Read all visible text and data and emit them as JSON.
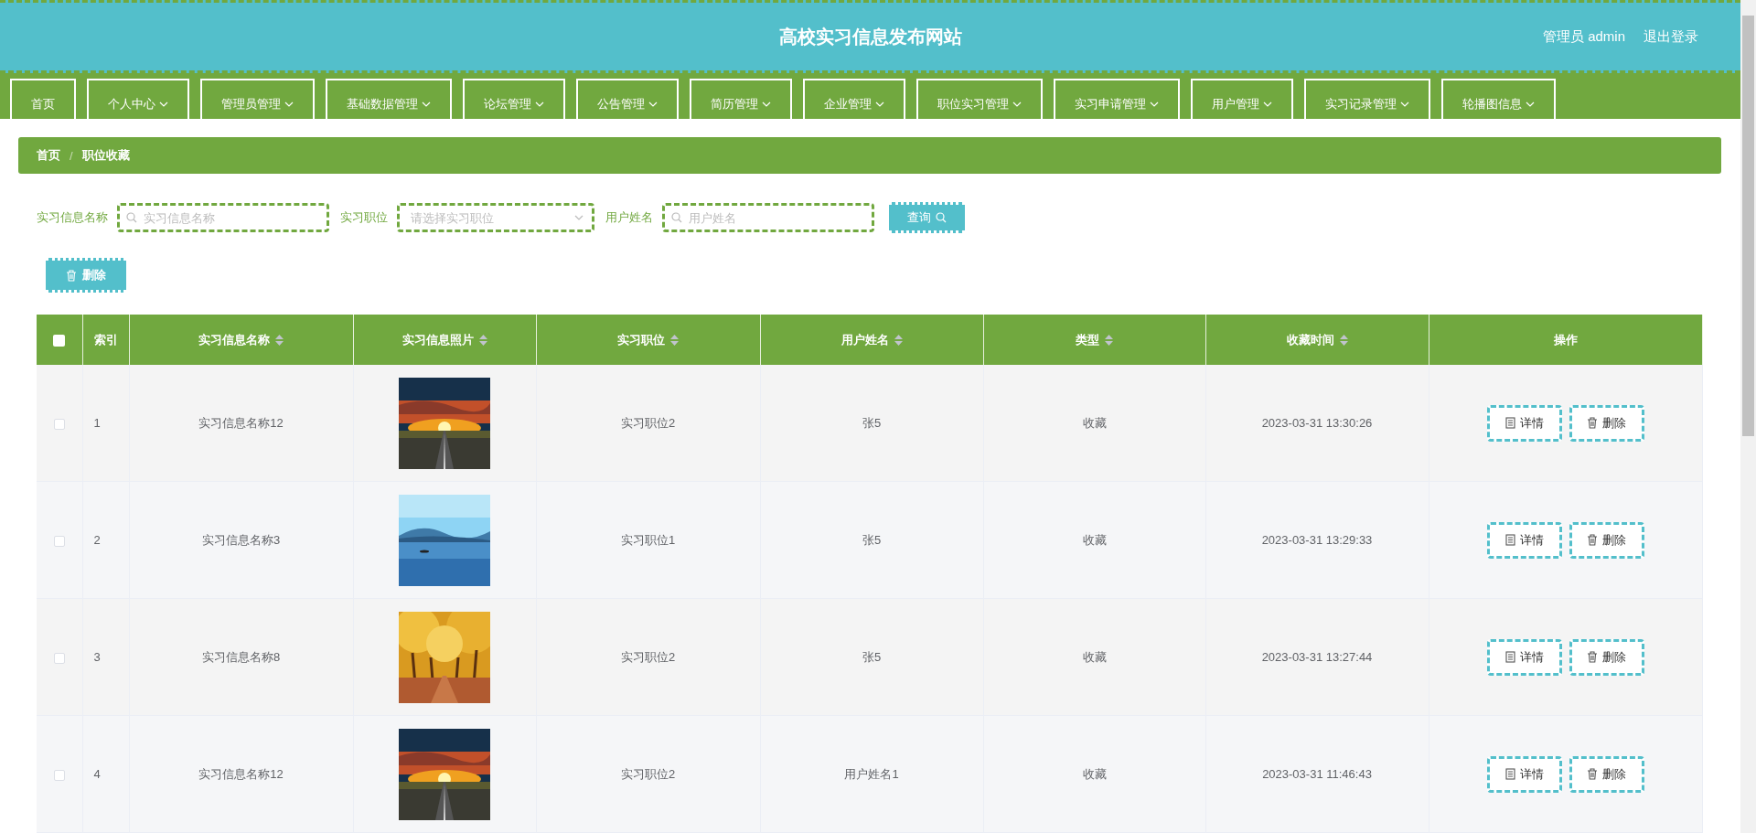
{
  "header": {
    "title": "高校实习信息发布网站",
    "user": "管理员 admin",
    "logout": "退出登录"
  },
  "nav": [
    {
      "label": "首页",
      "dropdown": false
    },
    {
      "label": "个人中心",
      "dropdown": true
    },
    {
      "label": "管理员管理",
      "dropdown": true
    },
    {
      "label": "基础数据管理",
      "dropdown": true
    },
    {
      "label": "论坛管理",
      "dropdown": true
    },
    {
      "label": "公告管理",
      "dropdown": true
    },
    {
      "label": "简历管理",
      "dropdown": true
    },
    {
      "label": "企业管理",
      "dropdown": true
    },
    {
      "label": "职位实习管理",
      "dropdown": true
    },
    {
      "label": "实习申请管理",
      "dropdown": true
    },
    {
      "label": "用户管理",
      "dropdown": true
    },
    {
      "label": "实习记录管理",
      "dropdown": true
    },
    {
      "label": "轮播图信息",
      "dropdown": true
    }
  ],
  "breadcrumb": {
    "items": [
      "首页",
      "职位收藏"
    ],
    "separator": "/"
  },
  "search": {
    "fields": [
      {
        "label": "实习信息名称",
        "kind": "text",
        "placeholder": "实习信息名称"
      },
      {
        "label": "实习职位",
        "kind": "select",
        "placeholder": "请选择实习职位"
      },
      {
        "label": "用户姓名",
        "kind": "text",
        "placeholder": "用户姓名"
      }
    ],
    "button": "查询"
  },
  "delete_button": "删除",
  "table": {
    "select_all": {
      "checked": false
    },
    "columns": [
      {
        "label": "索引",
        "sortable": false
      },
      {
        "label": "实习信息名称",
        "sortable": true
      },
      {
        "label": "实习信息照片",
        "sortable": true
      },
      {
        "label": "实习职位",
        "sortable": true
      },
      {
        "label": "用户姓名",
        "sortable": true
      },
      {
        "label": "类型",
        "sortable": true
      },
      {
        "label": "收藏时间",
        "sortable": true
      },
      {
        "label": "操作",
        "sortable": false
      }
    ],
    "rows": [
      {
        "checked": false,
        "index": "1",
        "name": "实习信息名称12",
        "photo": {
          "kind": "picture"
        },
        "position": "实习职位2",
        "user": "张5",
        "type": "收藏",
        "time": "2023-03-31 13:30:26",
        "actions": [
          "详情",
          "删除"
        ]
      },
      {
        "checked": false,
        "index": "2",
        "name": "实习信息名称3",
        "photo": {
          "kind": "picture"
        },
        "position": "实习职位1",
        "user": "张5",
        "type": "收藏",
        "time": "2023-03-31 13:29:33",
        "actions": [
          "详情",
          "删除"
        ]
      },
      {
        "checked": false,
        "index": "3",
        "name": "实习信息名称8",
        "photo": {
          "kind": "picture"
        },
        "position": "实习职位2",
        "user": "张5",
        "type": "收藏",
        "time": "2023-03-31 13:27:44",
        "actions": [
          "详情",
          "删除"
        ]
      },
      {
        "checked": false,
        "index": "4",
        "name": "实习信息名称12",
        "photo": {
          "kind": "picture"
        },
        "position": "实习职位2",
        "user": "用户姓名1",
        "type": "收藏",
        "time": "2023-03-31 11:46:43",
        "actions": [
          "详情",
          "删除"
        ]
      }
    ]
  }
}
